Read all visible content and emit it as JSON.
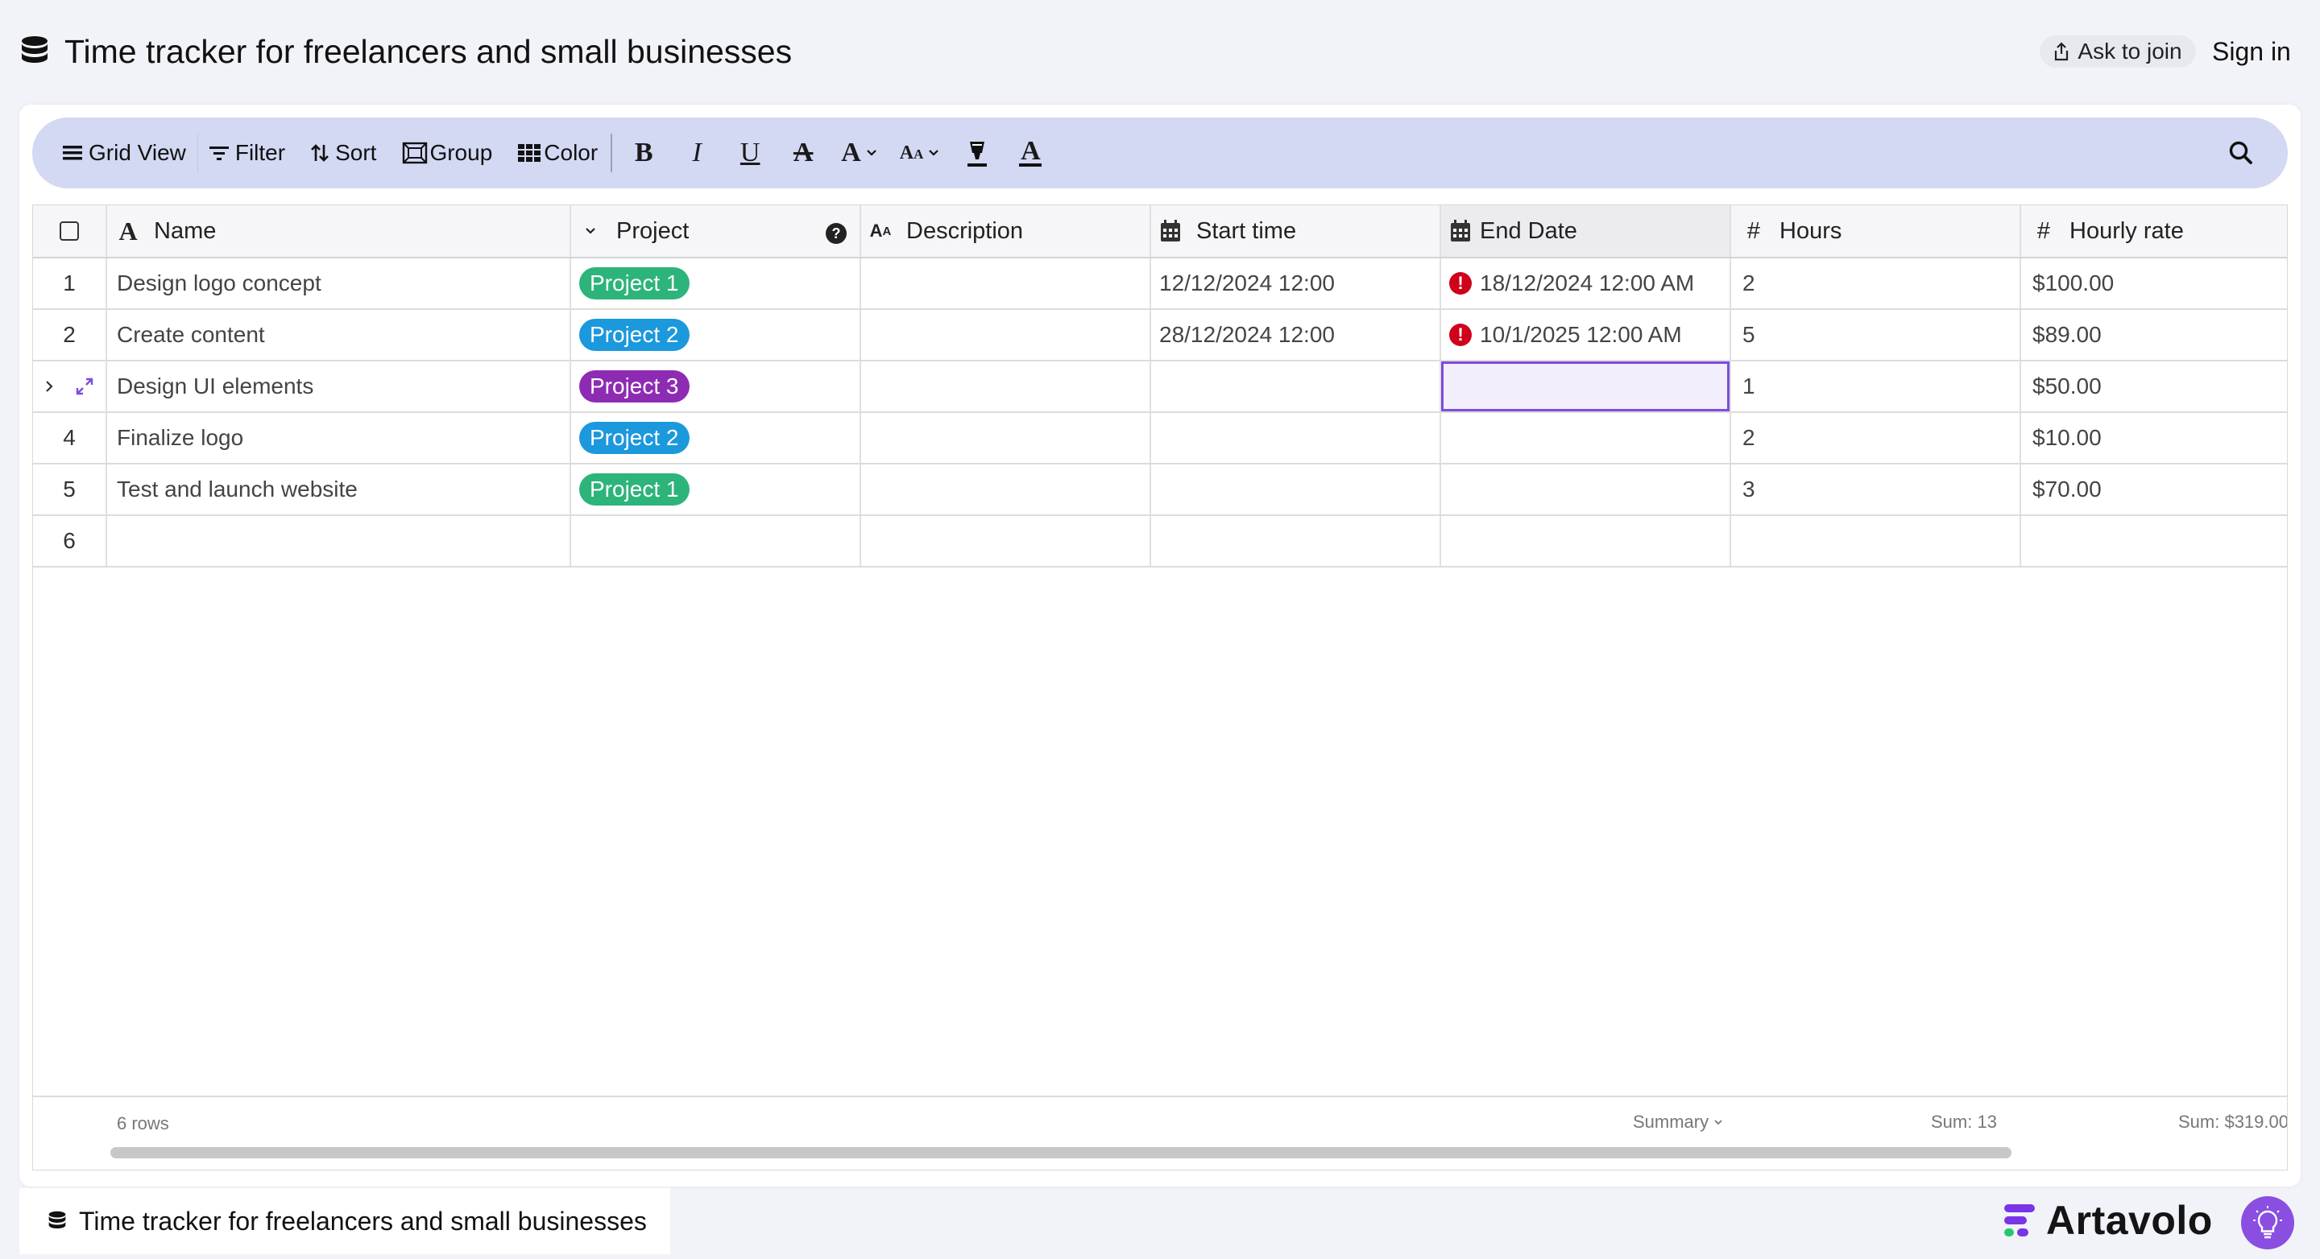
{
  "header": {
    "title": "Time tracker for freelancers and small businesses",
    "ask_to_join": "Ask to join",
    "sign_in": "Sign in"
  },
  "toolbar": {
    "grid_view": "Grid View",
    "filter": "Filter",
    "sort": "Sort",
    "group": "Group",
    "color": "Color",
    "format_buttons": [
      "bold",
      "italic",
      "underline",
      "strikethrough",
      "text-color",
      "text-size",
      "highlight",
      "font-color"
    ]
  },
  "columns": {
    "name": "Name",
    "project": "Project",
    "description": "Description",
    "start_time": "Start time",
    "end_date": "End Date",
    "hours": "Hours",
    "hourly_rate": "Hourly rate"
  },
  "rows": [
    {
      "num": "1",
      "name": "Design logo concept",
      "project": "Project 1",
      "project_color": "#2db47a",
      "start": "12/12/2024 12:00",
      "end": "18/12/2024 12:00 AM",
      "end_error": true,
      "hours": "2",
      "rate": "$100.00"
    },
    {
      "num": "2",
      "name": "Create content",
      "project": "Project 2",
      "project_color": "#1c98dc",
      "start": "28/12/2024 12:00",
      "end": "10/1/2025 12:00 AM",
      "end_error": true,
      "hours": "5",
      "rate": "$89.00"
    },
    {
      "num": "",
      "name": "Design UI elements",
      "project": "Project 3",
      "project_color": "#8e2bb3",
      "start": "",
      "end": "",
      "end_error": false,
      "hours": "1",
      "rate": "$50.00",
      "hovered": true,
      "end_selected": true
    },
    {
      "num": "4",
      "name": "Finalize logo",
      "project": "Project 2",
      "project_color": "#1c98dc",
      "start": "",
      "end": "",
      "end_error": false,
      "hours": "2",
      "rate": "$10.00"
    },
    {
      "num": "5",
      "name": "Test and launch website",
      "project": "Project 1",
      "project_color": "#2db47a",
      "start": "",
      "end": "",
      "end_error": false,
      "hours": "3",
      "rate": "$70.00"
    },
    {
      "num": "6",
      "name": "",
      "project": "",
      "project_color": "",
      "start": "",
      "end": "",
      "end_error": false,
      "hours": "",
      "rate": ""
    }
  ],
  "footer": {
    "rows_count": "6 rows",
    "summary": "Summary",
    "sum_hours": "Sum: 13",
    "sum_rate": "Sum: $319.00"
  },
  "bottom": {
    "tab_title": "Time tracker for freelancers and small businesses",
    "brand": "Artavolo"
  },
  "colors": {
    "accent": "#7c4ddb",
    "toolbar_bg": "#d3d8f3",
    "error": "#d0021b"
  }
}
